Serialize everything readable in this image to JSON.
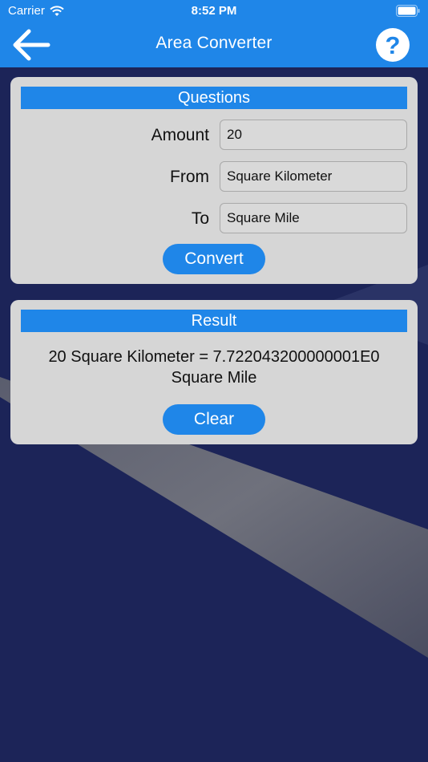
{
  "status_bar": {
    "carrier": "Carrier",
    "time": "8:52 PM"
  },
  "nav": {
    "title": "Area Converter",
    "back_icon": "arrow-left-icon",
    "help_icon": "question-circle-icon"
  },
  "questions": {
    "heading": "Questions",
    "amount_label": "Amount",
    "amount_value": "20",
    "from_label": "From",
    "from_value": "Square Kilometer",
    "to_label": "To",
    "to_value": "Square Mile",
    "convert_label": "Convert"
  },
  "result": {
    "heading": "Result",
    "line1": "20 Square Kilometer = 7.722043200000001E0",
    "line2": "Square Mile",
    "clear_label": "Clear"
  },
  "colors": {
    "accent": "#1f86e8",
    "card": "#d6d6d6",
    "background": "#1c2458"
  }
}
